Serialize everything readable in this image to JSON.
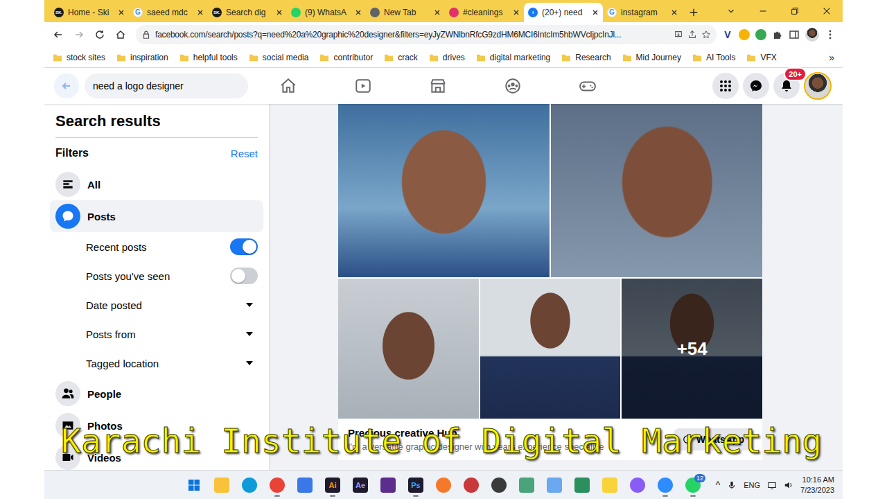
{
  "browser": {
    "tabs": [
      {
        "label": "Home - Ski",
        "selected": false,
        "icon": {
          "kind": "badge",
          "text": "SK.",
          "color": "#1b1b1b"
        }
      },
      {
        "label": "saeed mdc",
        "selected": false,
        "icon": {
          "kind": "letter",
          "text": "G",
          "color": "#4285f4"
        }
      },
      {
        "label": "Search dig",
        "selected": false,
        "icon": {
          "kind": "badge",
          "text": "SK.",
          "color": "#1b1b1b"
        }
      },
      {
        "label": "(9) WhatsA",
        "selected": false,
        "icon": {
          "kind": "dot",
          "color": "#25d366"
        }
      },
      {
        "label": "New Tab",
        "selected": false,
        "icon": {
          "kind": "dot",
          "color": "#5f6368"
        }
      },
      {
        "label": "#cleanings",
        "selected": false,
        "icon": {
          "kind": "dot",
          "color": "#e1306c"
        }
      },
      {
        "label": "(20+) need",
        "selected": true,
        "icon": {
          "kind": "badge",
          "text": "f",
          "color": "#1877f2"
        }
      },
      {
        "label": "instagram",
        "selected": false,
        "icon": {
          "kind": "letter",
          "text": "G",
          "color": "#4285f4"
        }
      }
    ],
    "forward_enabled": false,
    "url": "facebook.com/search/posts?q=need%20a%20graphic%20designer&filters=eyJyZWNlbnRfcG9zdHM6MCI6IntcIm5hbWVcIjpcInJl...",
    "extensions": [
      {
        "kind": "text",
        "text": "V",
        "color": "#1a3a8f"
      },
      {
        "kind": "dot",
        "color": "#f4b400"
      },
      {
        "kind": "dot",
        "color": "#34a853"
      }
    ],
    "bookmarks": [
      "stock sites",
      "inspiration",
      "helpful tools",
      "social media",
      "contributor",
      "crack",
      "drives",
      "digital marketing",
      "Research",
      "Mid Journey",
      "AI Tools",
      "VFX"
    ],
    "bookmarks_more": "»"
  },
  "facebook": {
    "search": {
      "value": "need a logo designer"
    },
    "notifications_badge": "20+",
    "sidebar": {
      "title": "Search results",
      "filters_label": "Filters",
      "reset": "Reset",
      "items": [
        {
          "label": "All",
          "kind": "main",
          "selected": false
        },
        {
          "label": "Posts",
          "kind": "main",
          "selected": true
        },
        {
          "label": "Recent posts",
          "kind": "toggle",
          "on": true
        },
        {
          "label": "Posts you've seen",
          "kind": "toggle",
          "on": false
        },
        {
          "label": "Date posted",
          "kind": "dropdown"
        },
        {
          "label": "Posts from",
          "kind": "dropdown"
        },
        {
          "label": "Tagged location",
          "kind": "dropdown"
        },
        {
          "label": "People",
          "kind": "main",
          "selected": false
        },
        {
          "label": "Photos",
          "kind": "main",
          "selected": false
        },
        {
          "label": "Videos",
          "kind": "main",
          "selected": false
        }
      ]
    },
    "post": {
      "more_count": "+54",
      "author": "Precious creative Hub",
      "text": "I'm a versatile graphic designer with years experience specialize",
      "button": "WhatsApp"
    }
  },
  "taskbar": {
    "apps": [
      {
        "kind": "tile",
        "color": "#f8c33a",
        "running": false
      },
      {
        "kind": "round",
        "color": "#0f9bd7",
        "running": false
      },
      {
        "kind": "round",
        "color": "#e94335",
        "running": true
      },
      {
        "kind": "tile",
        "color": "#3b78e7",
        "running": false
      },
      {
        "kind": "text",
        "text": "Ai",
        "color": "#ff9a00",
        "running": true
      },
      {
        "kind": "text",
        "text": "Ae",
        "color": "#9999ff",
        "running": false
      },
      {
        "kind": "tile",
        "color": "#5b2d8c",
        "running": false
      },
      {
        "kind": "text",
        "text": "Ps",
        "color": "#31a8ff",
        "running": true
      },
      {
        "kind": "round",
        "color": "#f5792a",
        "running": false
      },
      {
        "kind": "round",
        "color": "#c9383a",
        "running": false
      },
      {
        "kind": "round",
        "color": "#3a3a3a",
        "running": false
      },
      {
        "kind": "tile",
        "color": "#4aa37a",
        "running": false
      },
      {
        "kind": "tile",
        "color": "#6aa8f0",
        "running": false
      },
      {
        "kind": "tile",
        "color": "#2c8f5e",
        "running": false
      },
      {
        "kind": "tile",
        "color": "#f8d33a",
        "running": false
      },
      {
        "kind": "round",
        "color": "#8a5cf6",
        "running": false
      },
      {
        "kind": "round",
        "color": "#2d8cff",
        "running": true
      },
      {
        "kind": "round",
        "color": "#25d366",
        "running": true,
        "badge": "12"
      }
    ],
    "tray": {
      "chevron": "^",
      "lang": "ENG",
      "time": "10:16 AM",
      "date": "7/23/2023"
    }
  },
  "watermark": "Karachi Institute of Digital Marketing"
}
